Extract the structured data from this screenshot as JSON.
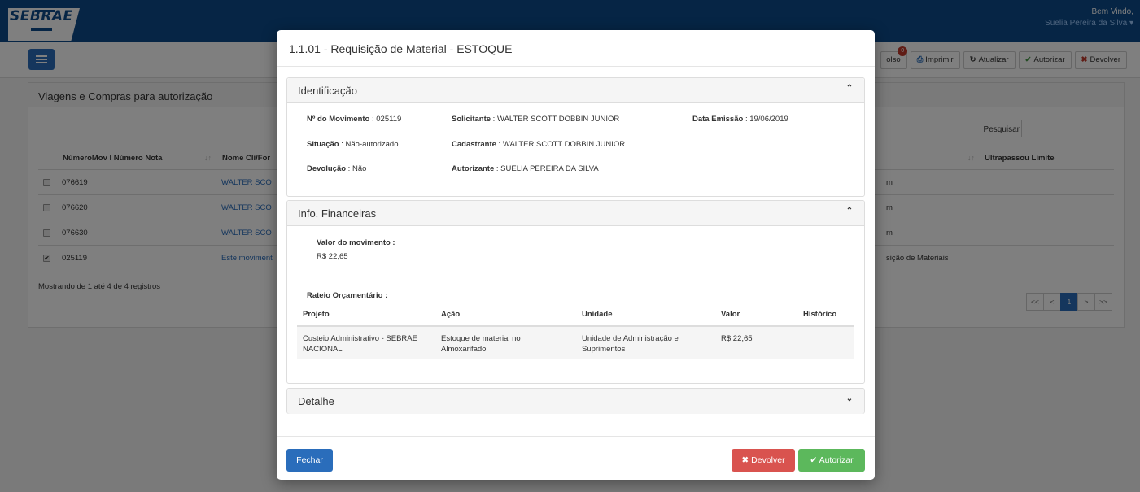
{
  "app": {
    "logo_text": "SEBRAE",
    "welcome": "Bem Vindo,",
    "user_name": "Suelia Pereira da Silva ▾"
  },
  "toolbar": {
    "reembolso_label": "olso",
    "reembolso_badge": "0",
    "imprimir_label": "Imprimir",
    "atualizar_label": "Atualizar",
    "autorizar_label": "Autorizar",
    "devolver_label": "Devolver"
  },
  "background_panel": {
    "title": "Viagens e Compras para autorização",
    "search_label": "Pesquisar",
    "search_value": "",
    "columns": [
      "NúmeroMov I Número Nota",
      "Nome Cli/For",
      "Ultrapassou Limite"
    ],
    "rows": [
      {
        "num": "076619",
        "link": "WALTER SCO",
        "right": "m",
        "checked": false
      },
      {
        "num": "076620",
        "link": "WALTER SCO",
        "right": "m",
        "checked": false
      },
      {
        "num": "076630",
        "link": "WALTER SCO",
        "right": "m",
        "checked": false
      },
      {
        "num": "025119",
        "link": "Este moviment",
        "right": "sição de Materiais",
        "checked": true
      }
    ],
    "footer_text": "Mostrando de 1 até 4 de 4 registros",
    "pager": [
      "<<",
      "<",
      "1",
      ">",
      ">>"
    ]
  },
  "modal": {
    "title": "1.1.01 - Requisição de Material - ESTOQUE",
    "identificacao": {
      "title": "Identificação",
      "num_movimento_label": "Nº do Movimento",
      "num_movimento_value": " : 025119",
      "solicitante_label": "Solicitante",
      "solicitante_value": " : WALTER SCOTT DOBBIN JUNIOR",
      "data_emissao_label": "Data Emissão",
      "data_emissao_value": " : 19/06/2019",
      "situacao_label": "Situação",
      "situacao_value": " : Não-autorizado",
      "cadastrante_label": "Cadastrante",
      "cadastrante_value": " : WALTER SCOTT DOBBIN JUNIOR",
      "devolucao_label": "Devolução",
      "devolucao_value": " : Não",
      "autorizante_label": "Autorizante",
      "autorizante_value": " : SUELIA PEREIRA DA SILVA"
    },
    "financeiras": {
      "title": "Info. Financeiras",
      "valor_label": "Valor do movimento :",
      "valor_value": "R$ 22,65",
      "rateio_label": "Rateio Orçamentário :",
      "columns": [
        "Projeto",
        "Ação",
        "Unidade",
        "Valor",
        "Histórico"
      ],
      "row": {
        "projeto_1": "Custeio Administrativo - SEBRAE",
        "projeto_2": "NACIONAL",
        "acao_1": "Estoque de material no",
        "acao_2": "Almoxarifado",
        "unidade_1": "Unidade de Administração e",
        "unidade_2": "Suprimentos",
        "valor": "R$ 22,65",
        "historico": ""
      }
    },
    "detalhe": {
      "title": "Detalhe"
    },
    "buttons": {
      "fechar": "Fechar",
      "devolver": "Devolver",
      "autorizar": "Autorizar"
    }
  }
}
